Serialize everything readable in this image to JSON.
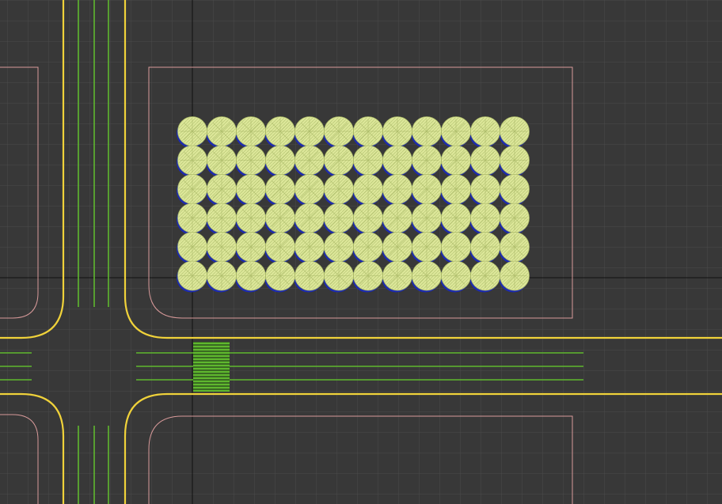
{
  "viewport": {
    "view": "top-orthographic",
    "content": "road-intersection-with-tree-block"
  },
  "colors": {
    "background": "#383838",
    "grid": "#4a4a4a",
    "axis": "#000000",
    "road_edge": "#f0d23a",
    "lane_marking": "#5fb82e",
    "crosswalk": "#5fb82e",
    "lot_boundary": "#d89a9a",
    "tree_canopy": "#dde79a",
    "tree_stroke": "#a9b866",
    "tree_shadow": "#1d2bb0"
  },
  "icons": {
    "tree": "tree-canopy-icon"
  },
  "tree_block": {
    "rows": 6,
    "columns": 12
  }
}
